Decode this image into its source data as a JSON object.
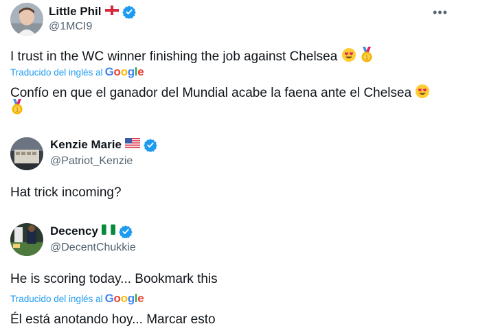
{
  "tweets": [
    {
      "name": "Little Phil",
      "handle": "@1MCI9",
      "flag": "england-flag",
      "original": "I trust in the WC winner finishing the job against Chelsea",
      "translated_label": "Traducido del inglés al",
      "google": [
        "G",
        "o",
        "o",
        "g",
        "l",
        "e"
      ],
      "translation_line1": "Confío en que el ganador del Mundial acabe la faena ante el Chelsea"
    },
    {
      "name": "Kenzie Marie",
      "handle": "@Patriot_Kenzie",
      "flag": "us-flag",
      "original": "Hat trick incoming?"
    },
    {
      "name": "Decency",
      "handle": "@DecentChukkie",
      "flag": "nigeria-flag",
      "original": "He is scoring today... Bookmark this",
      "translated_label": "Traducido del inglés al",
      "google": [
        "G",
        "o",
        "o",
        "g",
        "l",
        "e"
      ],
      "translation_line1": "Él está anotando hoy... Marcar esto"
    }
  ],
  "more_label": "•••",
  "colors": {
    "verified": "#1d9bf0",
    "link": "#1d9bf0",
    "secondary": "#536471"
  }
}
